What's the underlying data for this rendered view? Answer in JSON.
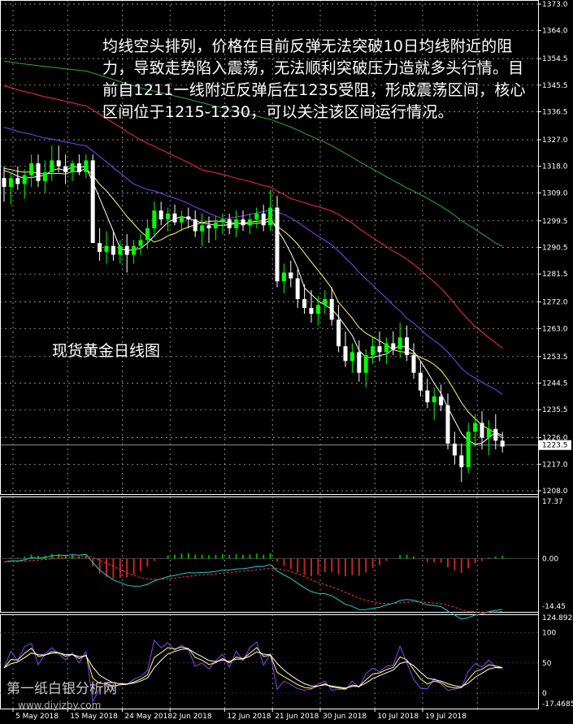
{
  "annotation": {
    "text": "均线空头排列，价格在目前反弹无法突破10日均线附近的阻力，导致走势陷入震荡，无法顺利突破压力造就多头行情。目前自1211一线附近反弹后在1235受阻，形成震荡区间，核心区间位于1215-1230，可以关注该区间运行情况。",
    "caption": "现货黄金日线图"
  },
  "watermark": {
    "name": "第一纸白银分析网",
    "url": "www.diyizby.com"
  },
  "colors": {
    "background": "#000000",
    "bull": "#00ff00",
    "bear": "#ffffff",
    "ma_fast": "#ffffff",
    "ma_10": "#ffff66",
    "ma_20": "#8844ff",
    "ma_30": "#ff2266",
    "ma_60": "#33aa33",
    "macd_signal": "#ff3333",
    "macd_line": "#22cccc",
    "stoch_main": "#ffff66",
    "stoch_signal": "#ffffff",
    "rsi": "#8844ff",
    "grid": "#c0c0c0"
  },
  "chart_data": [
    {
      "type": "candlestick",
      "panel": "price",
      "y_ticks": [
        "1373.0",
        "1364.0",
        "1354.5",
        "1345.5",
        "1336.5",
        "1327.0",
        "1318.0",
        "1309.0",
        "1299.5",
        "1290.5",
        "1281.5",
        "1272.0",
        "1263.0",
        "1253.5",
        "1244.5",
        "1235.5",
        "1226.0",
        "1217.0",
        "1208.0"
      ],
      "ylim": [
        1208.0,
        1373.0
      ],
      "current_price": "1223.5",
      "x_ticks": [
        "5 May 2018",
        "15 May 2018",
        "24 May 2018",
        "2 Jun 2018",
        "12 Jun 2018",
        "21 Jun 2018",
        "30 Jun 2018",
        "10 Jul 2018",
        "19 Jul 2018"
      ],
      "ohlc": [
        [
          1314,
          1318,
          1306,
          1311
        ],
        [
          1311,
          1316,
          1305,
          1314
        ],
        [
          1314,
          1318,
          1310,
          1312
        ],
        [
          1312,
          1317,
          1307,
          1315
        ],
        [
          1315,
          1322,
          1311,
          1319
        ],
        [
          1319,
          1322,
          1311,
          1313
        ],
        [
          1313,
          1320,
          1309,
          1316
        ],
        [
          1316,
          1325,
          1313,
          1320
        ],
        [
          1320,
          1325,
          1316,
          1318
        ],
        [
          1318,
          1322,
          1312,
          1316
        ],
        [
          1316,
          1320,
          1313,
          1319
        ],
        [
          1319,
          1322,
          1315,
          1316
        ],
        [
          1316,
          1322,
          1314,
          1320
        ],
        [
          1320,
          1322,
          1296,
          1292
        ],
        [
          1292,
          1297,
          1286,
          1289
        ],
        [
          1289,
          1296,
          1285,
          1291
        ],
        [
          1291,
          1296,
          1286,
          1288
        ],
        [
          1288,
          1293,
          1285,
          1291
        ],
        [
          1291,
          1295,
          1282,
          1288
        ],
        [
          1288,
          1293,
          1285,
          1291
        ],
        [
          1291,
          1295,
          1288,
          1293
        ],
        [
          1293,
          1300,
          1290,
          1297
        ],
        [
          1297,
          1306,
          1294,
          1303
        ],
        [
          1303,
          1306,
          1298,
          1300
        ],
        [
          1300,
          1304,
          1296,
          1302
        ],
        [
          1302,
          1305,
          1298,
          1299
        ],
        [
          1299,
          1303,
          1296,
          1301
        ],
        [
          1301,
          1304,
          1297,
          1300
        ],
        [
          1300,
          1303,
          1294,
          1296
        ],
        [
          1296,
          1302,
          1291,
          1298
        ],
        [
          1298,
          1301,
          1292,
          1297
        ],
        [
          1297,
          1301,
          1293,
          1299
        ],
        [
          1299,
          1302,
          1295,
          1300
        ],
        [
          1300,
          1302,
          1295,
          1297
        ],
        [
          1297,
          1303,
          1294,
          1300
        ],
        [
          1300,
          1303,
          1296,
          1298
        ],
        [
          1298,
          1302,
          1295,
          1300
        ],
        [
          1300,
          1304,
          1297,
          1302
        ],
        [
          1302,
          1305,
          1296,
          1298
        ],
        [
          1298,
          1310,
          1296,
          1304
        ],
        [
          1304,
          1308,
          1277,
          1279
        ],
        [
          1279,
          1285,
          1275,
          1282
        ],
        [
          1282,
          1286,
          1277,
          1280
        ],
        [
          1280,
          1283,
          1270,
          1273
        ],
        [
          1273,
          1278,
          1268,
          1270
        ],
        [
          1270,
          1276,
          1265,
          1268
        ],
        [
          1268,
          1274,
          1264,
          1271
        ],
        [
          1271,
          1276,
          1268,
          1273
        ],
        [
          1273,
          1277,
          1264,
          1266
        ],
        [
          1266,
          1271,
          1255,
          1257
        ],
        [
          1257,
          1262,
          1250,
          1252
        ],
        [
          1252,
          1258,
          1248,
          1255
        ],
        [
          1255,
          1259,
          1245,
          1248
        ],
        [
          1248,
          1256,
          1243,
          1254
        ],
        [
          1254,
          1260,
          1251,
          1257
        ],
        [
          1257,
          1262,
          1252,
          1255
        ],
        [
          1255,
          1260,
          1251,
          1258
        ],
        [
          1258,
          1262,
          1254,
          1256
        ],
        [
          1256,
          1265,
          1253,
          1260
        ],
        [
          1260,
          1264,
          1252,
          1254
        ],
        [
          1254,
          1258,
          1246,
          1248
        ],
        [
          1248,
          1252,
          1240,
          1242
        ],
        [
          1242,
          1246,
          1236,
          1238
        ],
        [
          1238,
          1243,
          1232,
          1240
        ],
        [
          1240,
          1244,
          1235,
          1237
        ],
        [
          1237,
          1241,
          1222,
          1224
        ],
        [
          1224,
          1228,
          1217,
          1220
        ],
        [
          1220,
          1224,
          1211,
          1216
        ],
        [
          1216,
          1231,
          1214,
          1228
        ],
        [
          1228,
          1234,
          1223,
          1231
        ],
        [
          1231,
          1235,
          1222,
          1226
        ],
        [
          1226,
          1232,
          1220,
          1229
        ],
        [
          1229,
          1234,
          1222,
          1225
        ],
        [
          1225,
          1228,
          1221,
          1223
        ]
      ]
    },
    {
      "type": "macd",
      "panel": "macd",
      "y_ticks": [
        "17.37",
        "0.00",
        "-14.45"
      ],
      "ylim": [
        -14.45,
        17.37
      ]
    },
    {
      "type": "oscillator",
      "panel": "stochastic_rsi",
      "y_ticks": [
        "124.8922",
        "100",
        "50",
        "0",
        "-17.4685"
      ],
      "ylim": [
        -17.4685,
        124.8922
      ]
    }
  ]
}
